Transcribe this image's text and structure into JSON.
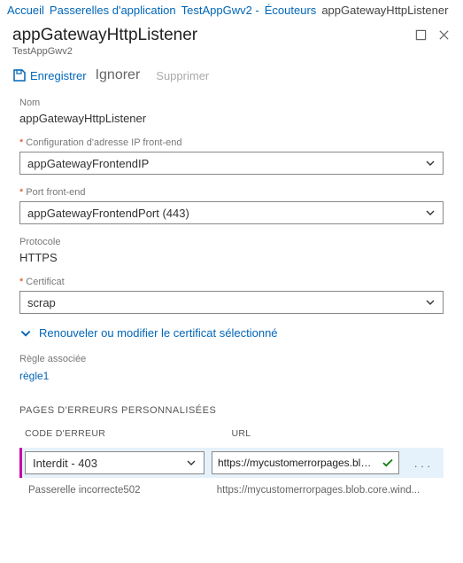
{
  "breadcrumbs": {
    "items": [
      {
        "label": "Accueil"
      },
      {
        "label": "Passerelles d'application"
      },
      {
        "label": "TestAppGwv2 -"
      },
      {
        "label": "Écouteurs"
      }
    ],
    "current": "appGatewayHttpListener"
  },
  "header": {
    "title": "appGatewayHttpListener",
    "subtitle": "TestAppGwv2"
  },
  "toolbar": {
    "save": "Enregistrer",
    "ignore": "Ignorer",
    "delete": "Supprimer"
  },
  "form": {
    "name_label": "Nom",
    "name_value": "appGatewayHttpListener",
    "frontend_ip_label": "Configuration d'adresse IP front-end",
    "frontend_ip_value": "appGatewayFrontendIP",
    "frontend_port_label": "Port front-end",
    "frontend_port_value": "appGatewayFrontendPort (443)",
    "protocol_label": "Protocole",
    "protocol_value": "HTTPS",
    "certificate_label": "Certificat",
    "certificate_value": "scrap",
    "renew_label": "Renouveler ou modifier le certificat sélectionné",
    "associated_rule_label": "Règle associée",
    "associated_rule_value": "règle1"
  },
  "errors": {
    "section_title": "PAGES D'ERREURS PERSONNALISÉES",
    "col_code": "CODE D'ERREUR",
    "col_url": "URL",
    "rows": [
      {
        "selected": true,
        "code_value": "Interdit -   403",
        "url_value": "https://mycustomerrorpages.blob.core.w"
      },
      {
        "static": true,
        "code_value": "Passerelle incorrecte502",
        "url_value": "https://mycustomerrorpages.blob.core.wind..."
      }
    ]
  }
}
